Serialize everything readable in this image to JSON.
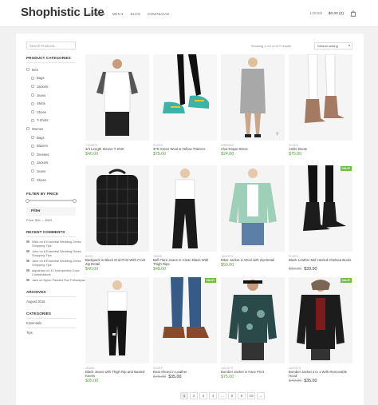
{
  "header": {
    "logo": "Shophistic Lite",
    "nav": [
      "WOMEN ▾",
      "MEN ▾",
      "BLOG",
      "DOWNLOAD"
    ],
    "login": "LOGIN",
    "cart": "$0.00 (0)"
  },
  "sidebar": {
    "search_placeholder": "Search Products...",
    "categories_title": "PRODUCT CATEGORIES",
    "categories": [
      {
        "label": "Men",
        "sub": false
      },
      {
        "label": "Bags",
        "sub": true
      },
      {
        "label": "Jackets",
        "sub": true
      },
      {
        "label": "Jeans",
        "sub": true
      },
      {
        "label": "Shirts",
        "sub": true
      },
      {
        "label": "Shoes",
        "sub": true
      },
      {
        "label": "T-Shirts",
        "sub": true
      },
      {
        "label": "Women",
        "sub": false
      },
      {
        "label": "Bags",
        "sub": true
      },
      {
        "label": "Blazers",
        "sub": true
      },
      {
        "label": "Dresses",
        "sub": true
      },
      {
        "label": "Jackets",
        "sub": true
      },
      {
        "label": "Jeans",
        "sub": true
      },
      {
        "label": "Shoes",
        "sub": true
      }
    ],
    "filter_title": "FILTER BY PRICE",
    "filter_button": "Filter",
    "price_label": "Price: $16 — $329",
    "comments_title": "RECENT COMMENTS",
    "comments": [
      "Wikk on 8 Essential Wedding Dress Shopping Tips",
      "John on 8 Essential Wedding Dress Shopping Tips",
      "Jane on 8 Essential Wedding Dress Shopping Tips",
      "aiquariam on 11 Unexpected Color Combinations",
      "Jack on Nylon Padded Flat Fl Backpack"
    ],
    "archives_title": "ARCHIVES",
    "archives": [
      "August 2015"
    ],
    "cats_title": "CATEGORIES",
    "cats": [
      "Essentials",
      "Tips"
    ]
  },
  "toolbar": {
    "results": "Showing 1–12 of 117 results",
    "sort": "Default sorting"
  },
  "products": [
    {
      "cat": "T-SHIRTS",
      "title": "3/4 Length Sleeve T-Shirt",
      "price": "$40.00",
      "old": "",
      "sale": false
    },
    {
      "cat": "SHOES",
      "title": "375 Green Wool & Yellow Trainers",
      "price": "$75.00",
      "old": "",
      "sale": false
    },
    {
      "cat": "DRESSES",
      "title": "Alva Drape Dress",
      "price": "$24.00",
      "old": "",
      "sale": false
    },
    {
      "cat": "SHOES",
      "title": "Ankle Boots",
      "price": "$75.00",
      "old": "",
      "sale": false
    },
    {
      "cat": "BAGS",
      "title": "Backpack in Black Grid Print With Front Zip Detail",
      "price": "$40.00",
      "old": "",
      "sale": false
    },
    {
      "cat": "JEANS",
      "title": "Bell Flare Jeans in Clean Black With Thigh Rips",
      "price": "$48.00",
      "old": "",
      "sale": false
    },
    {
      "cat": "JACKETS",
      "title": "Biker Jacket in Wool with Zip Detail",
      "price": "$50.00",
      "old": "",
      "sale": false
    },
    {
      "cat": "SHOES",
      "title": "Black Leather Mid Heeled Chelsea Boots",
      "price": "$39.00",
      "old": "$50.00",
      "sale": true
    },
    {
      "cat": "JEANS",
      "title": "Black Jeans with Thigh Rip and Busted Knees",
      "price": "$35.00",
      "old": "",
      "sale": false
    },
    {
      "cat": "SHOES",
      "title": "Boat Shoes in Leather",
      "price": "$35.00",
      "old": "$75.00",
      "sale": true
    },
    {
      "cat": "JACKETS",
      "title": "Bomber Jacket in Face Print",
      "price": "$75.00",
      "old": "",
      "sale": false
    },
    {
      "cat": "JACKETS",
      "title": "Bomber Jacket 2 in 1 With Removable Hood",
      "price": "$35.00",
      "old": "$40.00",
      "sale": true
    }
  ],
  "pagination": [
    "1",
    "2",
    "3",
    "4",
    "…",
    "8",
    "9",
    "10",
    "→"
  ],
  "colors": {
    "price": "#5aa53a",
    "sale_badge": "#6cbf3f"
  }
}
